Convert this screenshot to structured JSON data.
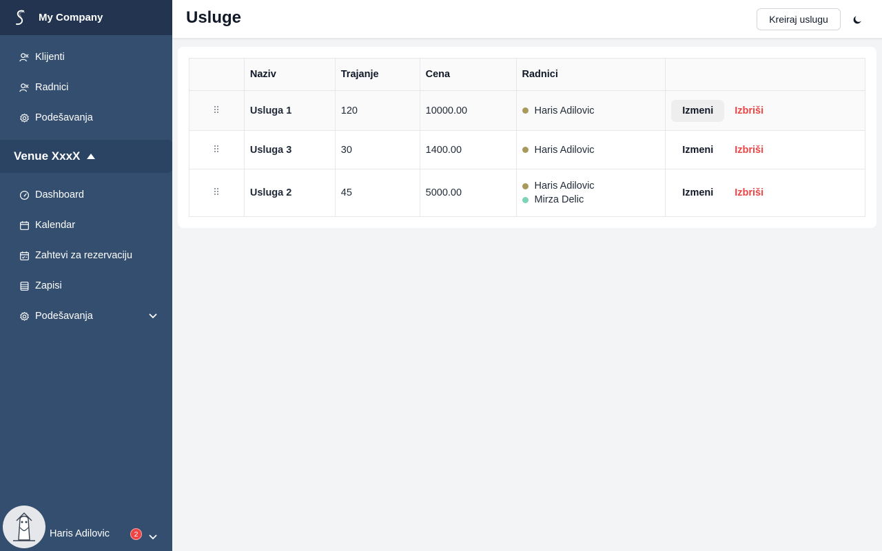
{
  "brand": {
    "name": "My Company"
  },
  "top_nav": [
    {
      "label": "Klijenti",
      "icon": "users-icon"
    },
    {
      "label": "Radnici",
      "icon": "workers-icon"
    },
    {
      "label": "Podešavanja",
      "icon": "gear-icon"
    }
  ],
  "venue": {
    "name": "Venue XxxX"
  },
  "venue_nav": [
    {
      "label": "Dashboard",
      "icon": "gauge-icon"
    },
    {
      "label": "Kalendar",
      "icon": "calendar-icon"
    },
    {
      "label": "Zahtevi za rezervaciju",
      "icon": "calendar-check-icon"
    },
    {
      "label": "Zapisi",
      "icon": "table-icon"
    },
    {
      "label": "Podešavanja",
      "icon": "gear-icon"
    }
  ],
  "user": {
    "name": "Haris Adilovic",
    "notifications": "2"
  },
  "header": {
    "title": "Usluge",
    "create_label": "Kreiraj uslugu"
  },
  "table": {
    "columns": [
      "",
      "Naziv",
      "Trajanje",
      "Cena",
      "Radnici",
      ""
    ],
    "rows": [
      {
        "name": "Usluga 1",
        "duration": "120",
        "price": "10000.00",
        "workers": [
          {
            "name": "Haris Adilovic",
            "color": "#a89a5c"
          }
        ],
        "edit": "Izmeni",
        "delete": "Izbriši"
      },
      {
        "name": "Usluga 3",
        "duration": "30",
        "price": "1400.00",
        "workers": [
          {
            "name": "Haris Adilovic",
            "color": "#a89a5c"
          }
        ],
        "edit": "Izmeni",
        "delete": "Izbriši"
      },
      {
        "name": "Usluga 2",
        "duration": "45",
        "price": "5000.00",
        "workers": [
          {
            "name": "Haris Adilovic",
            "color": "#a89a5c"
          },
          {
            "name": "Mirza Delic",
            "color": "#7dd3b5"
          }
        ],
        "edit": "Izmeni",
        "delete": "Izbriši"
      }
    ]
  },
  "colors": {
    "sidebar": "#344e6f",
    "brand_bar": "#22344f",
    "delete": "#ef4444"
  }
}
